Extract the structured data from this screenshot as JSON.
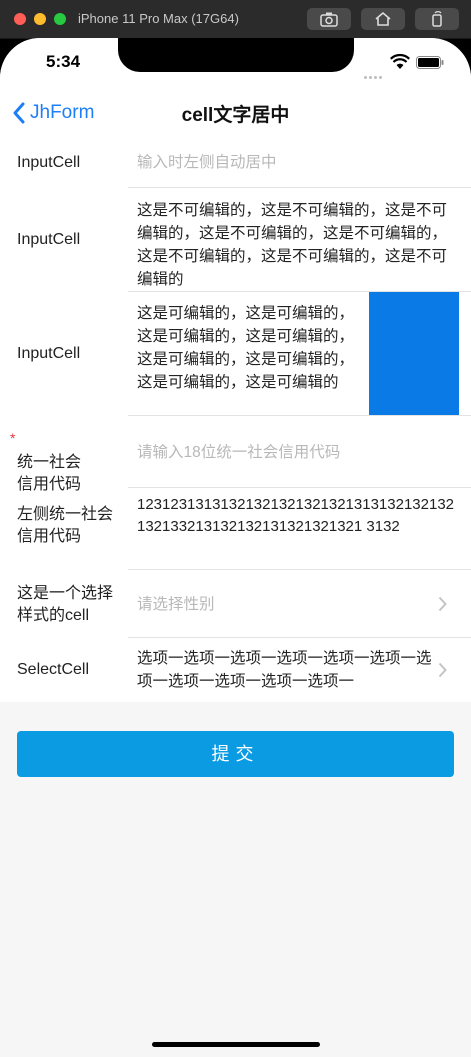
{
  "simulator": {
    "title": "iPhone 11 Pro Max (17G64)"
  },
  "status": {
    "time": "5:34"
  },
  "nav": {
    "back_label": "JhForm",
    "title": "cell文字居中"
  },
  "rows": [
    {
      "label": "InputCell",
      "value": "输入时左侧自动居中",
      "is_placeholder": true
    },
    {
      "label": "InputCell",
      "value": "这是不可编辑的，这是不可编辑的，这是不可编辑的，这是不可编辑的，这是不可编辑的，这是不可编辑的，这是不可编辑的，这是不可编辑的"
    },
    {
      "label": "InputCell",
      "value": "这是可编辑的，这是可编辑的，这是可编辑的，这是可编辑的，这是可编辑的，这是可编辑的，这是可编辑的，这是可编辑的"
    },
    {
      "label": "统一社会\n信用代码",
      "value": "请输入18位统一社会信用代码",
      "is_placeholder": true,
      "required": "*"
    },
    {
      "label": "左侧统一社会\n信用代码",
      "value": "12312313131321321321321321313132132132132133213132132131321321321 3132"
    },
    {
      "label": "这是一个选择\n样式的cell",
      "value": "请选择性别",
      "is_placeholder": true
    },
    {
      "label": "SelectCell",
      "value": "选项一选项一选项一选项一选项一选项一选项一选项一选项一选项一选项一"
    }
  ],
  "submit": {
    "label": "提交"
  },
  "colors": {
    "accent": "#1d7ef7",
    "submit_bg": "#0a9be2",
    "required": "#e23b3b",
    "placeholder": "#b8b8b8"
  }
}
